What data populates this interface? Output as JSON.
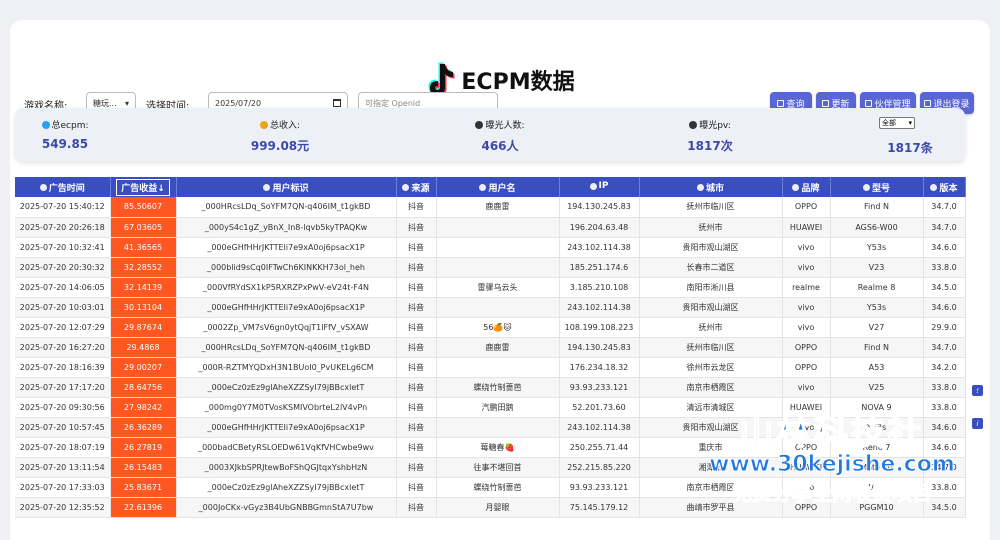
{
  "title": "ECPM数据",
  "filters": {
    "game_label": "游戏名称:",
    "game_value": "糖玩...",
    "time_label": "选择时间:",
    "date_value": "2025/07/20",
    "openid_placeholder": "可指定 Openid"
  },
  "buttons": {
    "query": "查询",
    "refresh": "更新",
    "partner": "伙伴管理",
    "logout": "退出登录"
  },
  "stats": {
    "ecpm_label": "总ecpm:",
    "ecpm_value": "549.85",
    "income_label": "总收入:",
    "income_value": "999.08元",
    "users_label": "曝光人数:",
    "users_value": "466人",
    "pv_label": "曝光pv:",
    "pv_value": "1817次",
    "select_value": "全部",
    "count_value": "1817条"
  },
  "columns": [
    "广告时间",
    "广告收益↓",
    "用户标识",
    "来源",
    "用户名",
    "IP",
    "城市",
    "品牌",
    "型号",
    "版本"
  ],
  "rows": [
    [
      "2025-07-20 15:40:12",
      "85.50607",
      "_000HRcsLDq_SoYFM7QN-q406IM_t1gkBD",
      "抖音",
      "鹿鹿雷",
      "194.130.245.83",
      "抚州市临川区",
      "OPPO",
      "Find N",
      "34.7.0"
    ],
    [
      "2025-07-20 20:26:18",
      "67.03605",
      "_000yS4c1gZ_yBnX_In8-lqvb5kyTPAQKw",
      "抖音",
      "",
      "196.204.63.48",
      "抚州市",
      "HUAWEI",
      "AGS6-W00",
      "34.7.0"
    ],
    [
      "2025-07-20 10:32:41",
      "41.36565",
      "_000eGHfHHrJKTTEIi7e9xA0oj6psacX1P",
      "抖音",
      "",
      "243.102.114.38",
      "贵阳市观山湖区",
      "vivo",
      "Y53s",
      "34.6.0"
    ],
    [
      "2025-07-20 20:30:32",
      "32.28552",
      "_000blid9sCq0IFTwCh6KINKKH73ol_heh",
      "抖音",
      "",
      "185.251.174.6",
      "长春市二道区",
      "vivo",
      "V23",
      "33.8.0"
    ],
    [
      "2025-07-20 14:06:05",
      "32.14139",
      "_000VfRYdSX1kP5RXRZPxPwV-eV24t-F4N",
      "抖音",
      "雷骤乌云头",
      "3.185.210.108",
      "南阳市淅川县",
      "realme",
      "Realme 8",
      "34.5.0"
    ],
    [
      "2025-07-20 10:03:01",
      "30.13104",
      "_000eGHfHHrJKTTEIi7e9xA0oj6psacX1P",
      "抖音",
      "",
      "243.102.114.38",
      "贵阳市观山湖区",
      "vivo",
      "Y53s",
      "34.6.0"
    ],
    [
      "2025-07-20 12:07:29",
      "29.87674",
      "_0002Zp_VM7sV6gn0ytQqjT1lFfV_vSXAW",
      "抖音",
      "56🍊🐱",
      "108.199.108.223",
      "抚州市",
      "vivo",
      "V27",
      "29.9.0"
    ],
    [
      "2025-07-20 16:27:20",
      "29.4868",
      "_000HRcsLDq_SoYFM7QN-q406IM_t1gkBD",
      "抖音",
      "鹿鹿雷",
      "194.130.245.83",
      "抚州市临川区",
      "OPPO",
      "Find N",
      "34.7.0"
    ],
    [
      "2025-07-20 18:16:39",
      "29.00207",
      "_000R-RZTMYQDxH3N1BUoI0_PvUKELg6CM",
      "抖音",
      "",
      "176.234.18.32",
      "徐州市云龙区",
      "OPPO",
      "A53",
      "34.2.0"
    ],
    [
      "2025-07-20 17:17:20",
      "28.64756",
      "_000eCz0zEz9glAheXZZSyI79jBBcxletT",
      "抖音",
      "蝶绕竹制蔷芭",
      "93.93.233.121",
      "南京市栖霞区",
      "vivo",
      "V25",
      "33.8.0"
    ],
    [
      "2025-07-20 09:30:56",
      "27.98242",
      "_000mg0Y7M0TVosKSMIVObrteL2lV4vPn",
      "抖音",
      "汽鹏田鹅",
      "52.201.73.60",
      "清远市清城区",
      "HUAWEI",
      "NOVA 9",
      "33.8.0"
    ],
    [
      "2025-07-20 10:57:45",
      "26.36289",
      "_000eGHfHHrJKTTEIi7e9xA0oj6psacX1P",
      "抖音",
      "",
      "243.102.114.38",
      "贵阳市观山湖区",
      "vivo",
      "Y53s",
      "34.6.0"
    ],
    [
      "2025-07-20 18:07:19",
      "26.27819",
      "_000badCBetyRSLOEDw61VqKfVHCwbe9wv",
      "抖音",
      "莓糖春🍓",
      "250.255.71.44",
      "重庆市",
      "OPPO",
      "Reno 7",
      "34.6.0"
    ],
    [
      "2025-07-20 13:11:54",
      "26.15483",
      "_0003XJkbSPRJtewBoFShQGJtqxYshbHzN",
      "抖音",
      "往事不堪回首",
      "252.215.85.220",
      "湘潭市",
      "HUAWEI",
      "Mate 40",
      "34.7.0"
    ],
    [
      "2025-07-20 17:33:03",
      "25.83671",
      "_000eCz0zEz9glAheXZZSyI79jBBcxletT",
      "抖音",
      "蝶绕竹制蔷芭",
      "93.93.233.121",
      "南京市栖霞区",
      "vivo",
      "V25",
      "33.8.0"
    ],
    [
      "2025-07-20 12:35:52",
      "22.61396",
      "_000JoCKx-vGyz3B4UbGNBBGmnStA7U7bw",
      "抖音",
      "月婴眼",
      "75.145.179.12",
      "曲靖市罗平县",
      "OPPO",
      "PGGM10",
      "34.5.0"
    ]
  ],
  "watermark": {
    "line1": "山林科技社",
    "line2": "www.30kejishe.com",
    "line3": "免费分享全网收费项目"
  },
  "colors": {
    "accent": "#3a4fbf",
    "revenue": "#ff5722",
    "watermark": "#1f79e0"
  }
}
